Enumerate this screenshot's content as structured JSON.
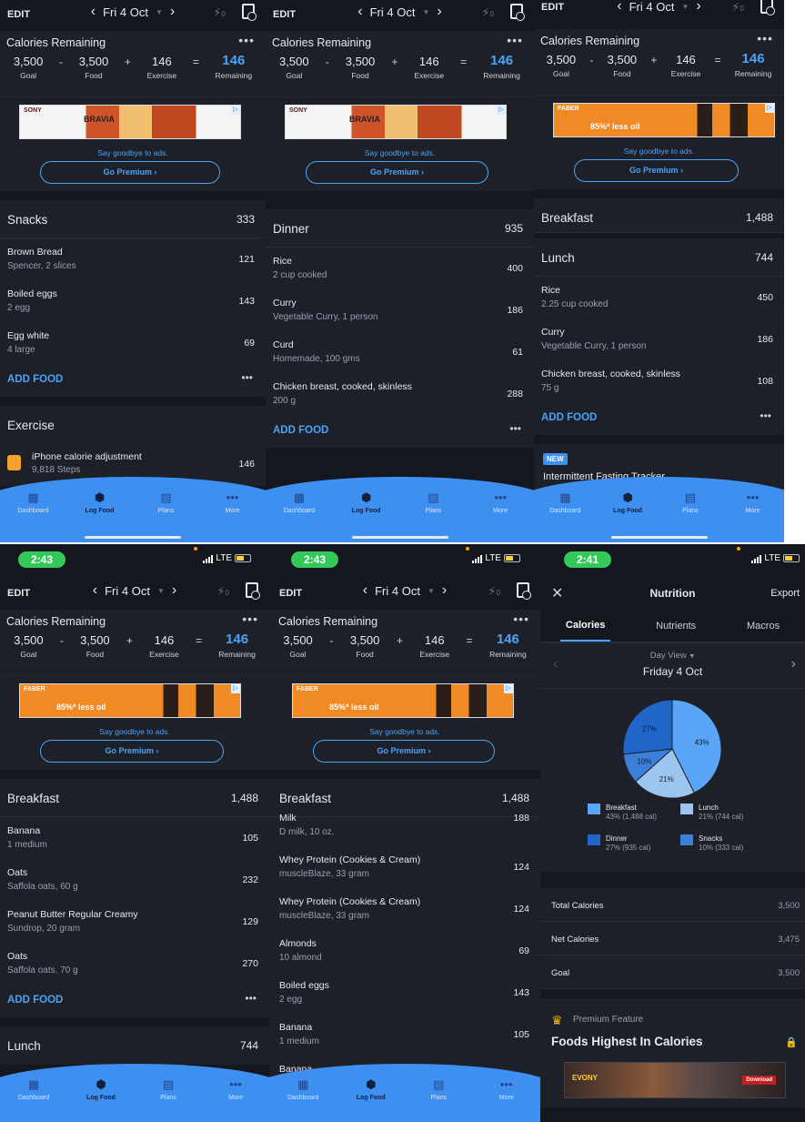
{
  "summary": {
    "title": "Calories Remaining",
    "goal": "3,500",
    "goal_label": "Goal",
    "food": "3,500",
    "food_label": "Food",
    "exercise": "146",
    "exercise_label": "Exercise",
    "remaining": "146",
    "remaining_label": "Remaining",
    "op_minus": "-",
    "op_plus": "+",
    "op_eq": "="
  },
  "nav": {
    "edit": "EDIT",
    "date": "Fri 4 Oct",
    "streak": "0"
  },
  "ad": {
    "sony_brand": "SONY",
    "sony_text": "BRAVIA",
    "faber_brand": "FABER",
    "faber_text": "85%* less oil",
    "goodbye": "Say goodbye to ads.",
    "premium": "Go Premium ›"
  },
  "tabs": [
    "Dashboard",
    "Log Food",
    "Plans",
    "More"
  ],
  "status": {
    "time_a": "2:43",
    "time_b": "2:41",
    "net": "LTE"
  },
  "p1": {
    "snacks": {
      "name": "Snacks",
      "total": "333",
      "items": [
        {
          "name": "Brown Bread",
          "desc": "Spencer, 2 slices",
          "cal": "121"
        },
        {
          "name": "Boiled eggs",
          "desc": "2 egg",
          "cal": "143"
        },
        {
          "name": "Egg white",
          "desc": "4 large",
          "cal": "69"
        }
      ]
    },
    "add": "ADD FOOD",
    "more": "•••",
    "exercise": {
      "name": "Exercise",
      "item": "iPhone calorie adjustment",
      "desc": "9,818 Steps",
      "cal": "146"
    }
  },
  "p2": {
    "dinner": {
      "name": "Dinner",
      "total": "935",
      "items": [
        {
          "name": "Rice",
          "desc": "2 cup cooked",
          "cal": "400"
        },
        {
          "name": "Curry",
          "desc": "Vegetable Curry, 1 person",
          "cal": "186"
        },
        {
          "name": "Curd",
          "desc": "Homemade, 100 gms",
          "cal": "61"
        },
        {
          "name": "Chicken breast, cooked, skinless",
          "desc": "200 g",
          "cal": "288"
        }
      ]
    },
    "add": "ADD FOOD"
  },
  "p3": {
    "breakfast": {
      "name": "Breakfast",
      "total": "1,488"
    },
    "lunch": {
      "name": "Lunch",
      "total": "744",
      "items": [
        {
          "name": "Rice",
          "desc": "2.25 cup cooked",
          "cal": "450"
        },
        {
          "name": "Curry",
          "desc": "Vegetable Curry, 1 person",
          "cal": "186"
        },
        {
          "name": "Chicken breast, cooked, skinless",
          "desc": "75 g",
          "cal": "108"
        }
      ]
    },
    "add": "ADD FOOD",
    "new": "NEW",
    "fasting": "Intermittent Fasting Tracker"
  },
  "p4": {
    "breakfast": {
      "name": "Breakfast",
      "total": "1,488",
      "items": [
        {
          "name": "Banana",
          "desc": "1 medium",
          "cal": "105"
        },
        {
          "name": "Oats",
          "desc": "Saffola oats, 60 g",
          "cal": "232"
        },
        {
          "name": "Peanut Butter Regular Creamy",
          "desc": "Sundrop, 20 gram",
          "cal": "129"
        },
        {
          "name": "Oats",
          "desc": "Saffola oats, 70 g",
          "cal": "270"
        }
      ]
    },
    "add": "ADD FOOD",
    "lunch": {
      "name": "Lunch",
      "total": "744"
    }
  },
  "p5": {
    "breakfast": {
      "name": "Breakfast",
      "total": "1,488",
      "items": [
        {
          "name": "Milk",
          "desc": "D milk, 10 oz.",
          "cal": "188"
        },
        {
          "name": "Whey Protein (Cookies & Cream)",
          "desc": "muscleBlaze, 33 gram",
          "cal": "124"
        },
        {
          "name": "Whey Protein (Cookies & Cream)",
          "desc": "muscleBlaze, 33 gram",
          "cal": "124"
        },
        {
          "name": "Almonds",
          "desc": "10 almond",
          "cal": "69"
        },
        {
          "name": "Boiled eggs",
          "desc": "2 egg",
          "cal": "143"
        },
        {
          "name": "Banana",
          "desc": "1 medium",
          "cal": "105"
        },
        {
          "name": "Banana",
          "desc": "",
          "cal": ""
        }
      ]
    }
  },
  "p6": {
    "close": "✕",
    "title": "Nutrition",
    "export": "Export",
    "tabs": [
      "Calories",
      "Nutrients",
      "Macros"
    ],
    "dayview": "Day View",
    "date": "Friday 4 Oct",
    "totals": [
      {
        "name": "Total Calories",
        "value": "3,500"
      },
      {
        "name": "Net Calories",
        "value": "3,475"
      },
      {
        "name": "Goal",
        "value": "3,500"
      }
    ],
    "premium": "Premium Feature",
    "highest": "Foods Highest In Calories",
    "game_ad": "EVONY",
    "game_btn": "Download"
  },
  "chart_data": {
    "type": "pie",
    "slices": [
      {
        "name": "Breakfast",
        "percent": 43,
        "label": "43% (1,488 cal)",
        "color": "#5aa5f5"
      },
      {
        "name": "Lunch",
        "percent": 21,
        "label": "21% (744 cal)",
        "color": "#9cc6f0"
      },
      {
        "name": "Snacks",
        "percent": 10,
        "label": "10% (333 cal)",
        "color": "#3a7fd8"
      },
      {
        "name": "Dinner",
        "percent": 27,
        "label": "27% (935 cal)",
        "color": "#1f66c8"
      }
    ],
    "legend_placement": "bottom"
  }
}
